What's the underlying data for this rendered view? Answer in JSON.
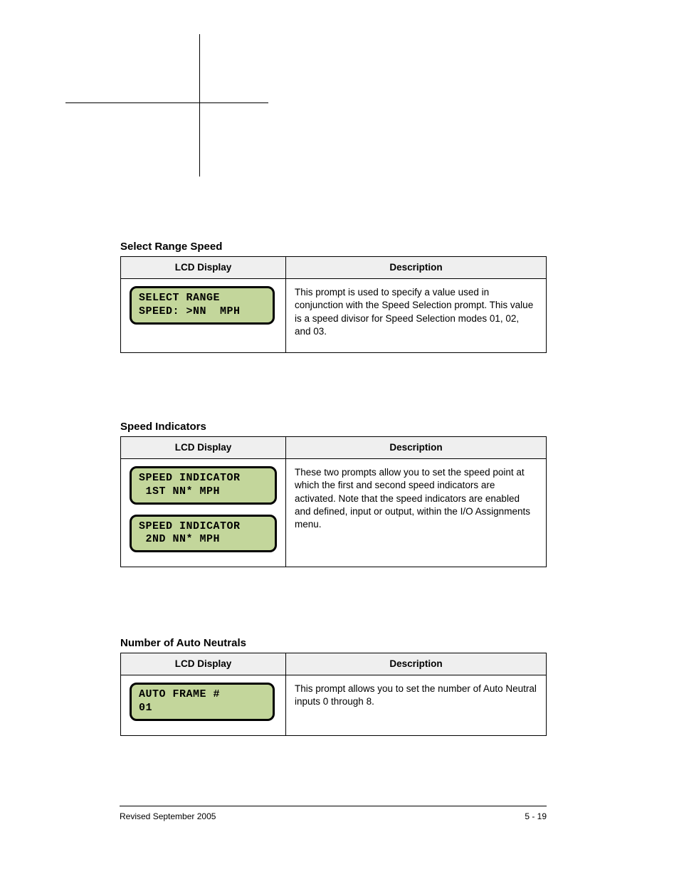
{
  "sections": {
    "s1": {
      "title": "Select Range Speed",
      "col1": "LCD Display",
      "col2": "Description",
      "lcd1_l1": "SELECT RANGE",
      "lcd1_l2": "SPEED: >NN  MPH",
      "desc": "This prompt is used to specify a value used in conjunction with the Speed Selection prompt. This value is a speed divisor for Speed Selection modes 01, 02, and 03."
    },
    "s2": {
      "title": "Speed Indicators",
      "col1": "LCD Display",
      "col2": "Description",
      "lcd1_l1": "SPEED INDICATOR",
      "lcd1_l2": " 1ST NN* MPH",
      "lcd2_l1": "SPEED INDICATOR",
      "lcd2_l2": " 2ND NN* MPH",
      "desc": "These two prompts allow you to set the speed point at which the first and second speed indicators are activated. Note that the speed indicators are enabled and defined, input or output, within the I/O Assignments menu."
    },
    "s3": {
      "title": "Number of Auto Neutrals",
      "col1": "LCD Display",
      "col2": "Description",
      "lcd1_l1": "AUTO FRAME #",
      "lcd1_l2": "01",
      "desc": "This prompt allows you to set the number of Auto Neutral inputs 0 through 8."
    }
  },
  "footer": {
    "left": "Revised September 2005",
    "right": "5 - 19"
  }
}
